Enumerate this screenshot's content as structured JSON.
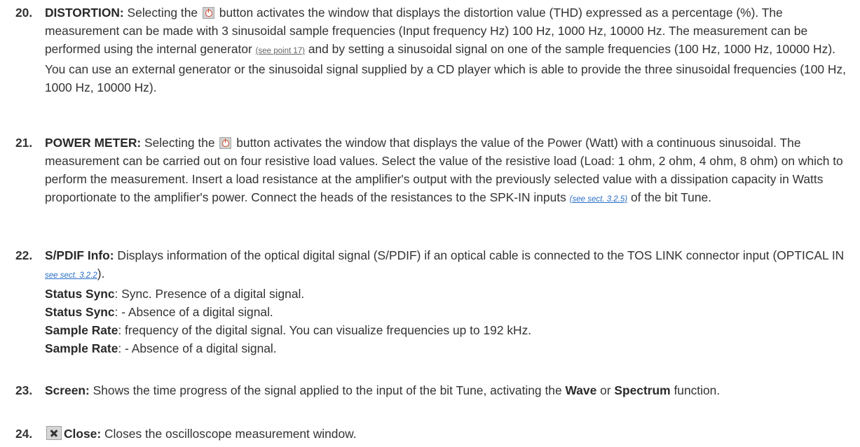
{
  "items": [
    {
      "number": "20.",
      "title": "DISTORTION:",
      "text_a": " Selecting the ",
      "icon": "power-button-icon",
      "text_b": " button activates the window that displays the distortion value (THD) expressed as a percentage (%). The measurement can be made with 3 sinusoidal sample frequencies (Input frequency Hz) 100 Hz, 1000 Hz, 10000 Hz. The measurement can be performed using the internal generator ",
      "ref": "(see point 17)",
      "text_c": " and by setting a sinusoidal signal on one of the sample frequencies (100 Hz, 1000 Hz, 10000 Hz). You can use an external generator or the sinusoidal signal supplied by a CD player which is able to provide the three sinusoidal frequencies (100 Hz, 1000 Hz, 10000 Hz)."
    },
    {
      "number": "21.",
      "title": "POWER METER:",
      "text_a": " Selecting the ",
      "icon": "power-button-icon",
      "text_b": " button activates the window that displays the value of the Power (Watt) with a continuous sinusoidal. The measurement can be carried out on four resistive load values. Select the value of the resistive load (Load: 1 ohm, 2 ohm, 4 ohm, 8 ohm) on which to perform the measurement. Insert a load resistance at the amplifier's output with the previously selected value with a dissipation capacity in Watts proportionate to the amplifier's power. Connect the heads of the resistances to the SPK-IN inputs ",
      "ref": "(see sect. 3.2.5)",
      "text_c": " of the bit Tune."
    },
    {
      "number": "22.",
      "title": "S/PDIF Info:",
      "text_a": " Displays information of the optical digital signal (S/PDIF) if an optical cable is connected to the TOS LINK connector input (OPTICAL IN ",
      "ref": "see sect. 3.2.2",
      "text_b": ").",
      "sublines": [
        {
          "label": "Status Sync",
          "text": ": Sync. Presence of a digital signal."
        },
        {
          "label": "Status Sync",
          "text": ": - Absence of a digital signal."
        },
        {
          "label": "Sample Rate",
          "text": ": frequency of the digital signal. You can visualize frequencies up to 192 kHz."
        },
        {
          "label": "Sample Rate",
          "text": ": - Absence of a digital signal."
        }
      ]
    },
    {
      "number": "23.",
      "title": "Screen:",
      "text_a": " Shows the time progress of the signal applied to the input of the bit Tune, activating the ",
      "bold_a": "Wave",
      "text_b": " or ",
      "bold_b": "Spectrum",
      "text_c": " function."
    },
    {
      "number": "24.",
      "icon": "close-x-icon",
      "title": "Close:",
      "text_a": " Closes the oscilloscope measurement window."
    }
  ]
}
